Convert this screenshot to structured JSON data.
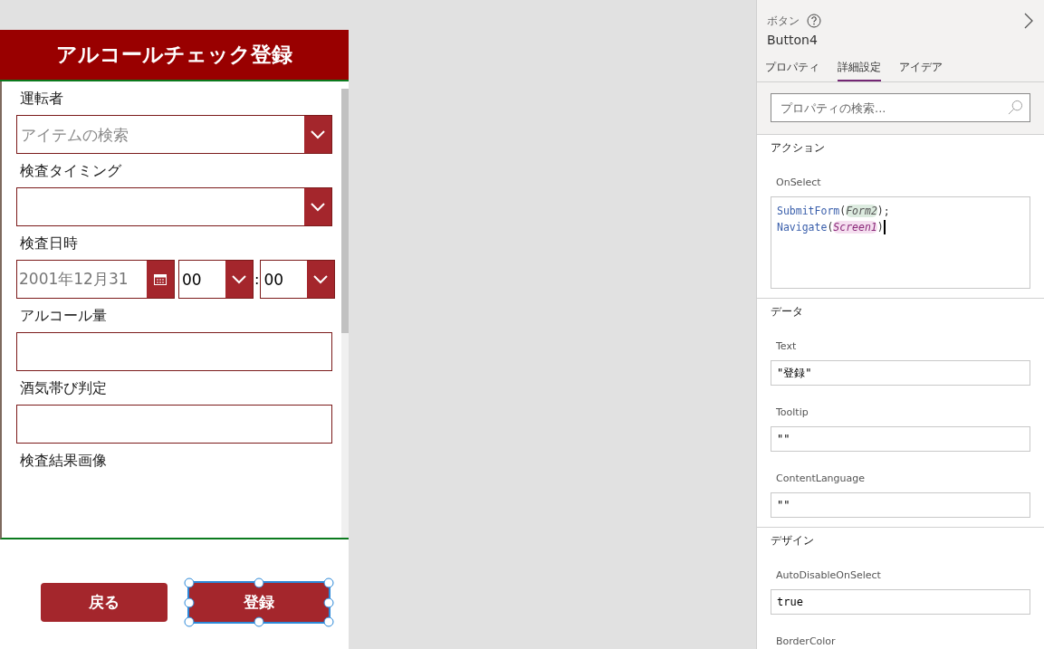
{
  "app": {
    "title": "アルコールチェック登録",
    "fields": [
      {
        "label": "運転者",
        "kind": "dropdown",
        "placeholder": "アイテムの検索"
      },
      {
        "label": "検査タイミング",
        "kind": "dropdown"
      },
      {
        "label": "検査日時",
        "kind": "datetime",
        "date": "2001年12月31",
        "hour": "00",
        "separator": ":",
        "minute": "00"
      },
      {
        "label": "アルコール量",
        "kind": "text"
      },
      {
        "label": "酒気帯び判定",
        "kind": "text"
      },
      {
        "label": "検査結果画像",
        "kind": "image"
      }
    ],
    "buttons": [
      {
        "label": "戻る",
        "selected": false
      },
      {
        "label": "登録",
        "selected": true
      }
    ]
  },
  "panel": {
    "control_type": "ボタン",
    "control_name": "Button4",
    "tabs": [
      {
        "label": "プロパティ",
        "selected": false
      },
      {
        "label": "詳細設定",
        "selected": true
      },
      {
        "label": "アイデア",
        "selected": false
      }
    ],
    "search": {
      "placeholder": "プロパティの検索..."
    },
    "sections": [
      {
        "title": "アクション",
        "properties": [
          {
            "name": "OnSelect",
            "kind": "formula",
            "lines": [
              [
                {
                  "text": "SubmitForm",
                  "kind": "function"
                },
                {
                  "text": "(",
                  "kind": "punct"
                },
                {
                  "text": "Form2",
                  "kind": "form"
                },
                {
                  "text": ")",
                  "kind": "punct"
                },
                {
                  "text": ";",
                  "kind": "punct"
                }
              ],
              [
                {
                  "text": "Navigate",
                  "kind": "function"
                },
                {
                  "text": "(",
                  "kind": "punct"
                },
                {
                  "text": "Screen1",
                  "kind": "screen"
                },
                {
                  "text": ")",
                  "kind": "punct"
                }
              ]
            ]
          }
        ]
      },
      {
        "title": "データ",
        "properties": [
          {
            "name": "Text",
            "kind": "plain",
            "value": "\"登録\""
          },
          {
            "name": "Tooltip",
            "kind": "plain",
            "value": "\"\""
          },
          {
            "name": "ContentLanguage",
            "kind": "plain",
            "value": "\"\""
          }
        ]
      },
      {
        "title": "デザイン",
        "properties": [
          {
            "name": "AutoDisableOnSelect",
            "kind": "plain",
            "value": "true"
          },
          {
            "name": "BorderColor",
            "kind": "label"
          }
        ]
      }
    ]
  }
}
